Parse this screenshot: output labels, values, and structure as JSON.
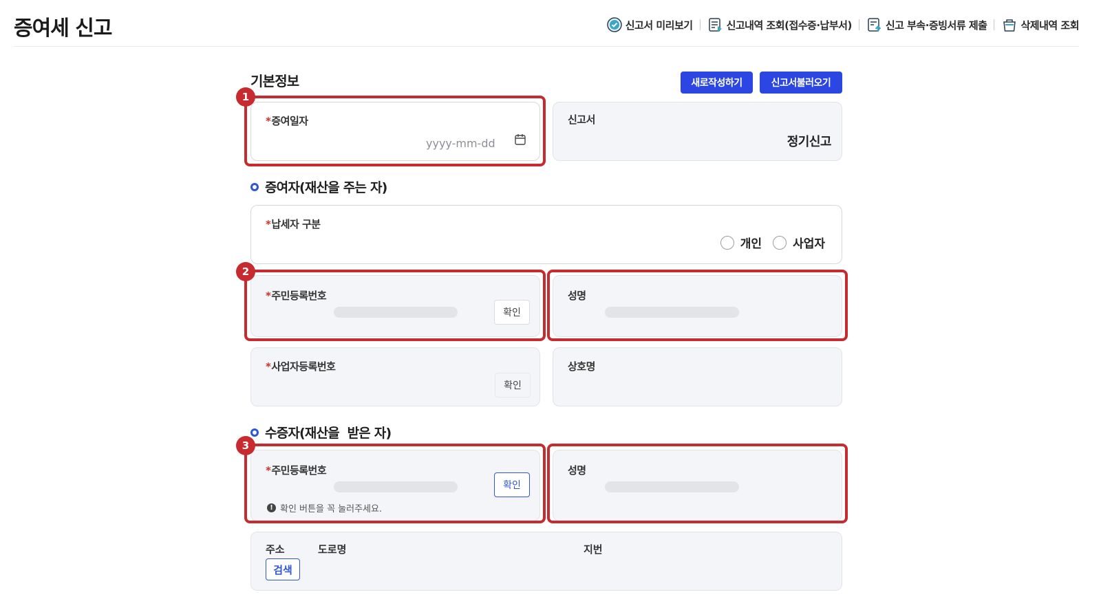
{
  "header": {
    "title": "증여세 신고",
    "links": [
      {
        "label": "신고서 미리보기",
        "icon": "check-circle-icon"
      },
      {
        "label": "신고내역 조회(접수증·납부서)",
        "icon": "document-list-icon"
      },
      {
        "label": "신고 부속·증빙서류 제출",
        "icon": "upload-document-icon"
      },
      {
        "label": "삭제내역 조회",
        "icon": "trash-icon"
      }
    ]
  },
  "basic": {
    "title": "기본정보",
    "new_button": "새로작성하기",
    "load_button": "신고서불러오기",
    "date_label": "증여일자",
    "date_placeholder": "yyyy-mm-dd",
    "report_label": "신고서",
    "report_value": "정기신고"
  },
  "donor": {
    "title": "증여자(재산을 주는 자)",
    "taxpayer_type_label": "납세자 구분",
    "options": [
      "개인",
      "사업자"
    ],
    "rrn_label": "주민등록번호",
    "confirm_label": "확인",
    "name_label": "성명",
    "bizno_label": "사업자등록번호",
    "biz_confirm_label": "확인",
    "company_label": "상호명"
  },
  "recipient": {
    "title": "수증자(재산을  받은 자)",
    "rrn_label": "주민등록번호",
    "confirm_label": "확인",
    "notice": "확인 버튼을 꼭 눌러주세요.",
    "name_label": "성명",
    "address_label": "주소",
    "road_label": "도로명",
    "lot_label": "지번",
    "search_label": "검색"
  },
  "badges": [
    "1",
    "2",
    "3"
  ],
  "colors": {
    "primary": "#2b46e2",
    "highlight": "#c72a2f",
    "required": "#d0312d"
  }
}
